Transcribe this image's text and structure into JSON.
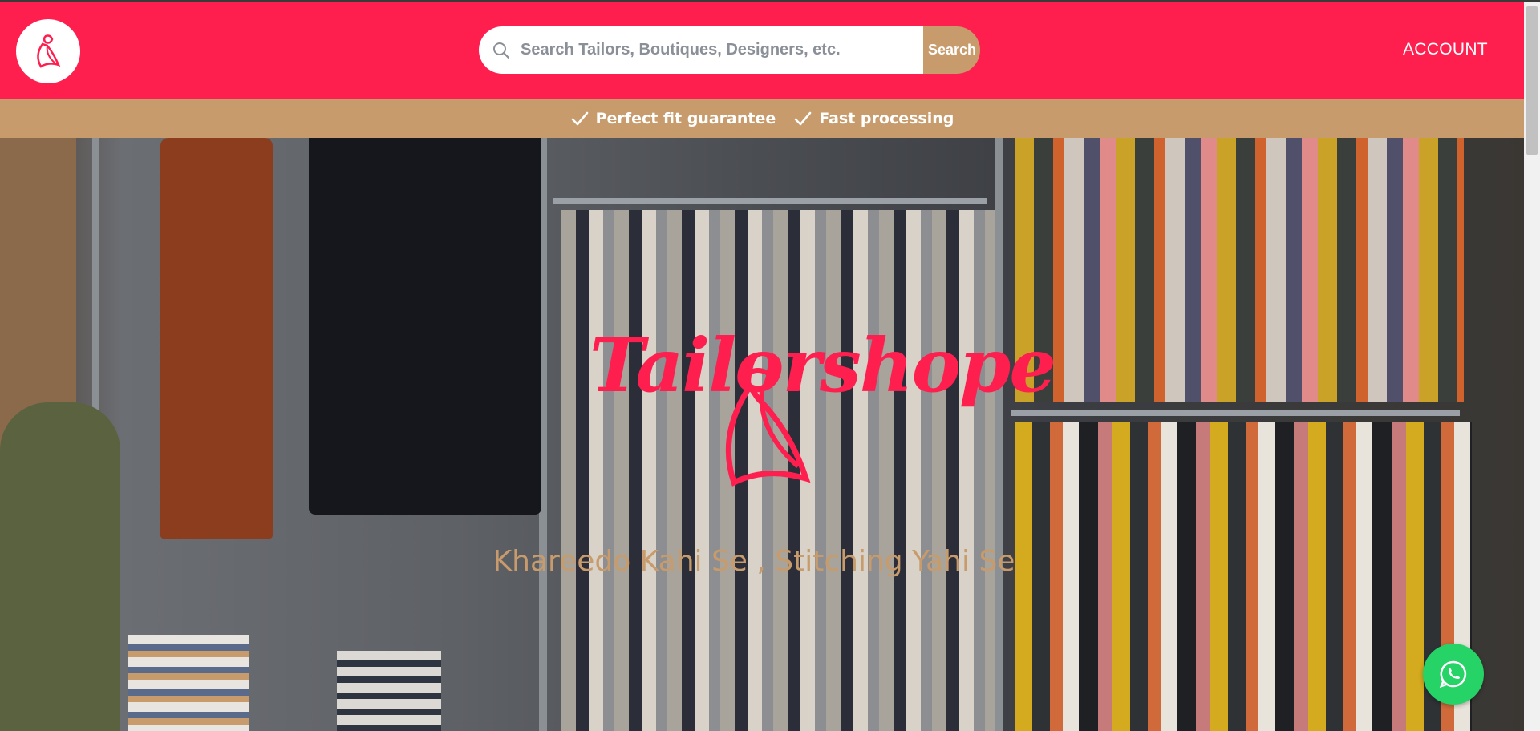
{
  "header": {
    "search_placeholder": "Search Tailors, Boutiques, Designers, etc.",
    "search_button": "Search",
    "account_label": "ACCOUNT"
  },
  "features": [
    {
      "label": "Perfect fit guarantee",
      "icon": "check-icon"
    },
    {
      "label": "Fast processing",
      "icon": "check-icon"
    }
  ],
  "hero": {
    "brand_logo_text": "Tailorshope",
    "tagline": "Khareedo Kahi Se , Stitching Yahi Se"
  },
  "colors": {
    "brand_pink": "#ff1f4f",
    "accent_tan": "#c79b6b",
    "whatsapp_green": "#25d366"
  },
  "icons": [
    "logo-icon",
    "search-icon",
    "check-icon",
    "whatsapp-icon"
  ]
}
